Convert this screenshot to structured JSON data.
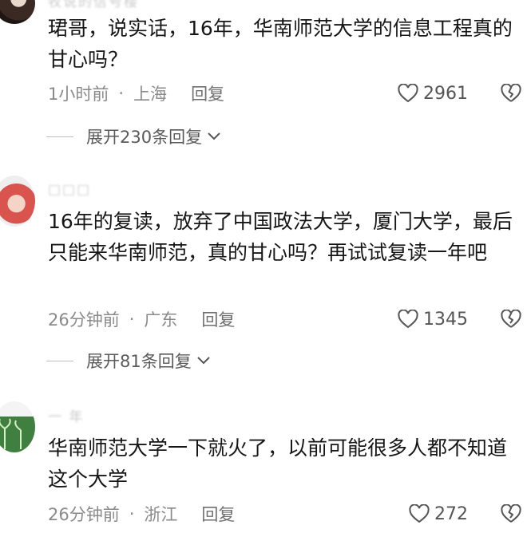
{
  "comments": [
    {
      "username": "牧说的信号楼",
      "text": "珺哥，说实话，16年，华南师范大学的信息工程真的甘心吗？",
      "time": "1小时前",
      "location": "上海",
      "reply_label": "回复",
      "likes": "2961",
      "expand_label": "展开230条回复"
    },
    {
      "username": "□□□",
      "text": "16年的复读，放弃了中国政法大学，厦门大学，最后只能来华南师范，真的甘心吗？再试试复读一年吧",
      "time": "26分钟前",
      "location": "广东",
      "reply_label": "回复",
      "likes": "1345",
      "expand_label": "展开81条回复"
    },
    {
      "username": "一 年",
      "text": "华南师范大学一下就火了，以前可能很多人都不知道这个大学",
      "time": "26分钟前",
      "location": "浙江",
      "reply_label": "回复",
      "likes": "272"
    }
  ],
  "icons": {
    "like": "heart-outline-icon",
    "dislike": "broken-heart-icon",
    "expand": "chevron-down-icon"
  },
  "colors": {
    "meta_text": "#8a8a8a",
    "body_text": "#161616",
    "icon": "#555555"
  }
}
